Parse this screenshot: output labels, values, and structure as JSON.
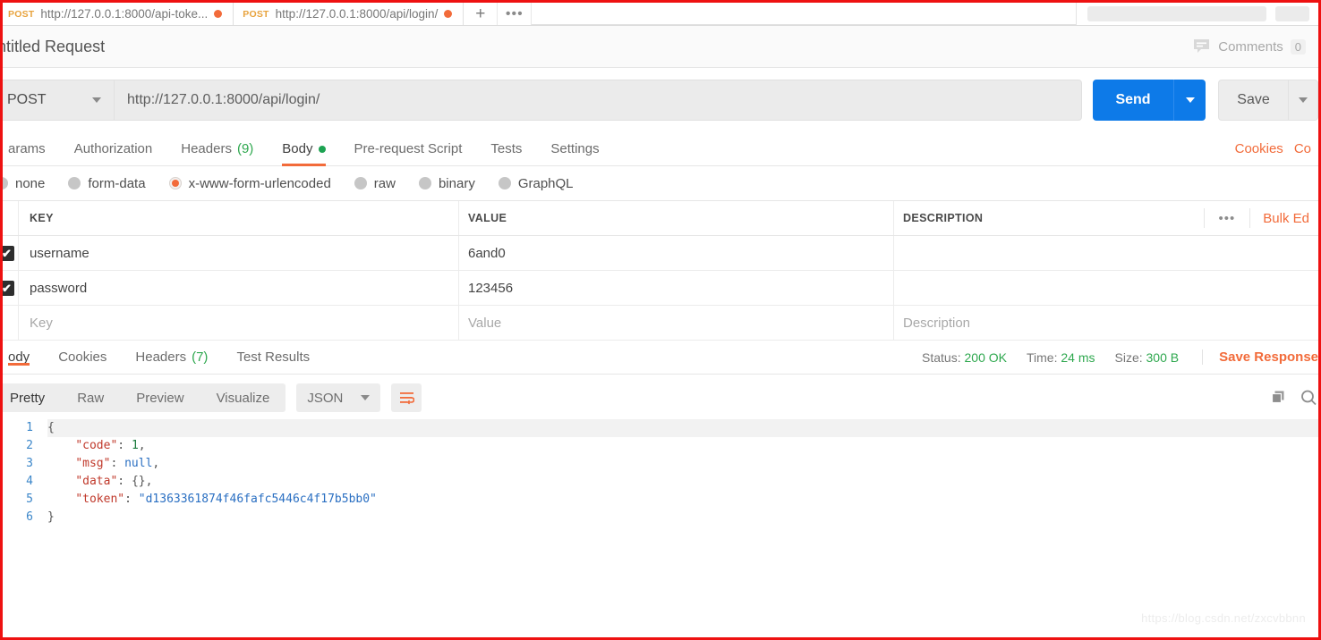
{
  "window": {
    "accent_orange": "#f26b3a",
    "accent_blue": "#0d7ae8",
    "accent_green": "#2fa84f"
  },
  "tabbar": {
    "tabs": [
      {
        "method": "POST",
        "url": "http://127.0.0.1:8000/api-toke...",
        "unsaved": true
      },
      {
        "method": "POST",
        "url": "http://127.0.0.1:8000/api/login/",
        "unsaved": true
      }
    ],
    "new_tab_icon": "plus-icon",
    "more_icon": "ellipsis-icon"
  },
  "title_row": {
    "request_name": "ntitled Request",
    "comments_label": "Comments",
    "comments_count": "0"
  },
  "url_row": {
    "method": "POST",
    "url": "http://127.0.0.1:8000/api/login/",
    "send_label": "Send",
    "save_label": "Save"
  },
  "request_tabs": {
    "items": [
      {
        "label": "arams",
        "active": false
      },
      {
        "label": "Authorization",
        "active": false
      },
      {
        "label": "Headers",
        "count": "(9)",
        "active": false
      },
      {
        "label": "Body",
        "active": true,
        "dot": true
      },
      {
        "label": "Pre-request Script",
        "active": false
      },
      {
        "label": "Tests",
        "active": false
      },
      {
        "label": "Settings",
        "active": false
      }
    ],
    "cookies_link": "Cookies",
    "code_link": "Co"
  },
  "body_types": {
    "options": [
      {
        "label": "none",
        "selected": false
      },
      {
        "label": "form-data",
        "selected": false
      },
      {
        "label": "x-www-form-urlencoded",
        "selected": true
      },
      {
        "label": "raw",
        "selected": false
      },
      {
        "label": "binary",
        "selected": false
      },
      {
        "label": "GraphQL",
        "selected": false
      }
    ]
  },
  "kv_table": {
    "headers": {
      "key": "KEY",
      "value": "VALUE",
      "description": "DESCRIPTION"
    },
    "more_icon": "ellipsis-icon",
    "bulk_edit_label": "Bulk Ed",
    "rows": [
      {
        "checked": true,
        "key": "username",
        "value": "6and0",
        "description": ""
      },
      {
        "checked": true,
        "key": "password",
        "value": "123456",
        "description": ""
      }
    ],
    "placeholder_row": {
      "key": "Key",
      "value": "Value",
      "description": "Description"
    }
  },
  "response_bar": {
    "tabs": [
      {
        "label": "ody",
        "active": true
      },
      {
        "label": "Cookies",
        "active": false
      },
      {
        "label": "Headers",
        "count": "(7)",
        "active": false
      },
      {
        "label": "Test Results",
        "active": false
      }
    ],
    "status_label": "Status:",
    "status_value": "200 OK",
    "time_label": "Time:",
    "time_value": "24 ms",
    "size_label": "Size:",
    "size_value": "300 B",
    "save_response_label": "Save Response"
  },
  "viewer_bar": {
    "segments": [
      {
        "label": "Pretty",
        "active": true
      },
      {
        "label": "Raw",
        "active": false
      },
      {
        "label": "Preview",
        "active": false
      },
      {
        "label": "Visualize",
        "active": false
      }
    ],
    "format": "JSON",
    "wrap_icon": "word-wrap-icon",
    "copy_icon": "copy-icon",
    "search_icon": "search-icon"
  },
  "response_body": {
    "line_numbers": [
      "1",
      "2",
      "3",
      "4",
      "5",
      "6"
    ],
    "json": {
      "code": 1,
      "msg": null,
      "data": {},
      "token": "d1363361874f46fafc5446c4f17b5bb0"
    },
    "lines": [
      {
        "n": "1",
        "text": "{"
      },
      {
        "n": "2",
        "text": "    \"code\": 1,"
      },
      {
        "n": "3",
        "text": "    \"msg\": null,"
      },
      {
        "n": "4",
        "text": "    \"data\": {},"
      },
      {
        "n": "5",
        "text": "    \"token\": \"d1363361874f46fafc5446c4f17b5bb0\""
      },
      {
        "n": "6",
        "text": "}"
      }
    ]
  },
  "watermark": "https://blog.csdn.net/zxcvbbnn"
}
